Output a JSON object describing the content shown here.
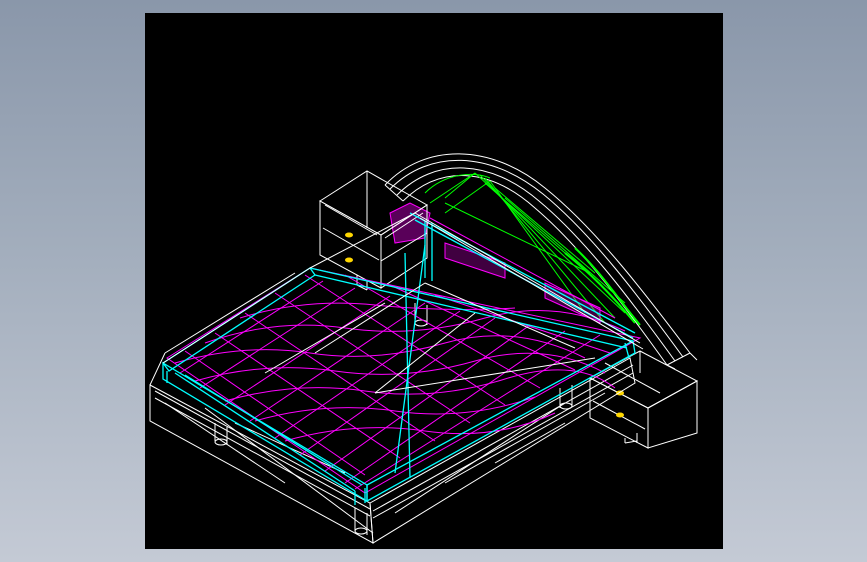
{
  "viewport": {
    "background": "#000000",
    "model": "bed-with-nightstands-wireframe"
  },
  "colors": {
    "frame": "#ffffff",
    "mattress": "#ff00ff",
    "rails": "#00ffff",
    "headboard_arch": "#00ff00",
    "drawer_knobs": "#ffd700",
    "page_gradient_top": "#8a97aa",
    "page_gradient_bottom": "#c4cad5"
  }
}
